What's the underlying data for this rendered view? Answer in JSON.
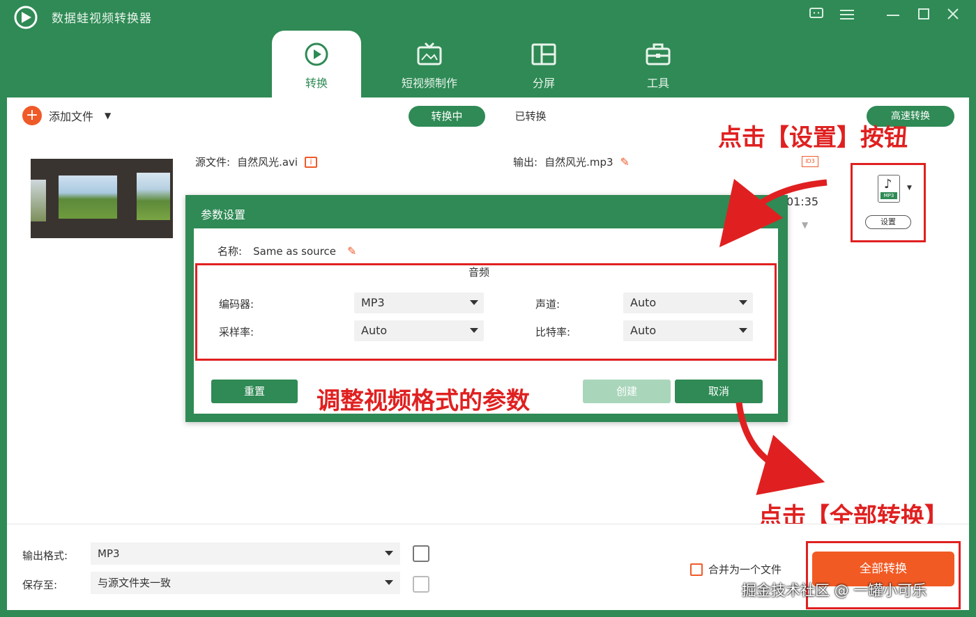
{
  "app": {
    "title": "数据蛙视频转换器",
    "logo_icon": "app-logo-icon",
    "window_controls": [
      "feedback-icon",
      "menu-icon",
      "minimize-icon",
      "maximize-icon",
      "close-icon"
    ]
  },
  "nav": [
    {
      "label": "转换",
      "icon": "convert-icon",
      "active": true
    },
    {
      "label": "短视频制作",
      "icon": "tv-icon",
      "active": false
    },
    {
      "label": "分屏",
      "icon": "split-screen-icon",
      "active": false
    },
    {
      "label": "工具",
      "icon": "toolbox-icon",
      "active": false
    }
  ],
  "toolbar": {
    "add_file": "添加文件",
    "tab_converting": "转换中",
    "tab_converted": "已转换",
    "fast_convert": "高速转换"
  },
  "file": {
    "source_label": "源文件:",
    "source_name": "自然风光.avi",
    "output_label": "输出:",
    "output_name": "自然风光.mp3",
    "duration": "01:35",
    "format_tag": "MP3",
    "settings_button": "设置"
  },
  "dialog": {
    "title": "参数设置",
    "name_label": "名称:",
    "name_value": "Same as source",
    "section": "音频",
    "encoder_label": "编码器:",
    "encoder_value": "MP3",
    "channel_label": "声道:",
    "channel_value": "Auto",
    "samplerate_label": "采样率:",
    "samplerate_value": "Auto",
    "bitrate_label": "比特率:",
    "bitrate_value": "Auto",
    "reset_button": "重置",
    "confirm_button": "创建",
    "cancel_button": "取消"
  },
  "annotations": {
    "click_settings": "点击【设置】按钮",
    "adjust_params": "调整视频格式的参数",
    "click_convert_all": "点击【全部转换】",
    "color": "#e02020"
  },
  "bottom": {
    "output_format_label": "输出格式:",
    "output_format_value": "MP3",
    "save_to_label": "保存至:",
    "save_to_value": "与源文件夹一致",
    "merge_label": "合并为一个文件",
    "convert_all": "全部转换"
  },
  "watermark": "掘金技术社区 @ 一罐小可乐",
  "colors": {
    "brand": "#2f8a55",
    "accent": "#f25a24"
  }
}
